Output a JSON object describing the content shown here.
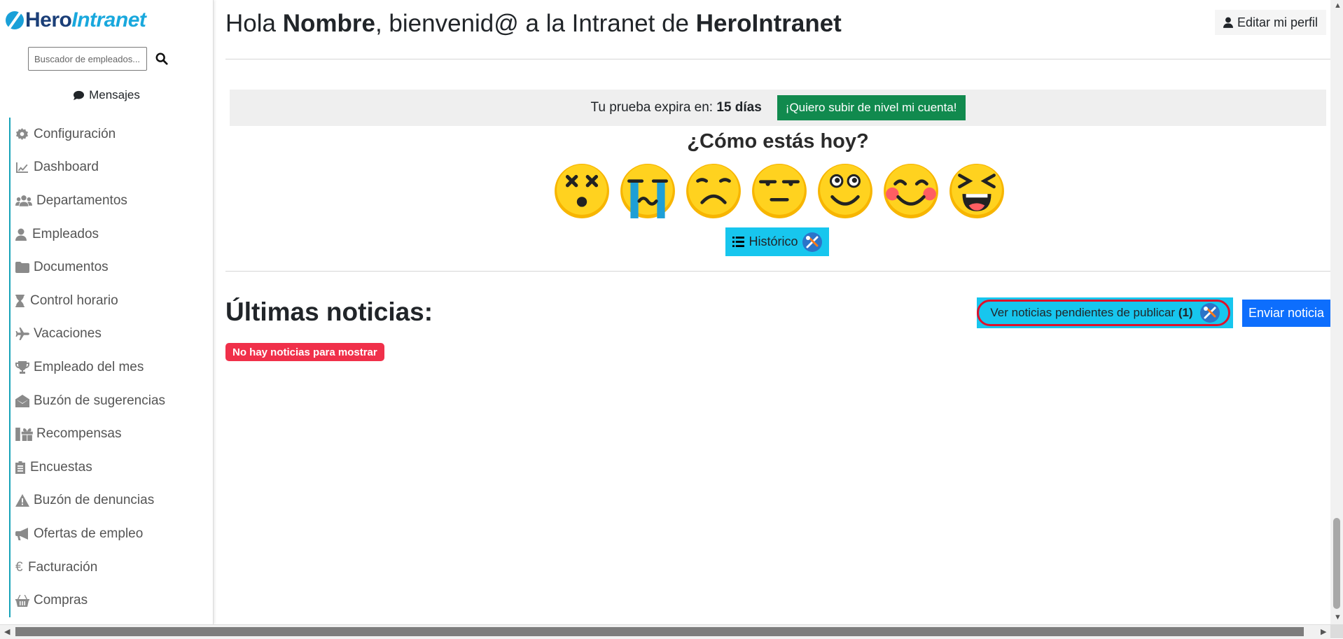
{
  "brand": {
    "hero": "Hero",
    "intranet": "Intranet"
  },
  "sidebar": {
    "search_placeholder": "Buscador de empleados...",
    "messages_label": "Mensajes",
    "items": [
      {
        "label": "Configuración",
        "icon": "gear-icon"
      },
      {
        "label": "Dashboard",
        "icon": "chart-line-icon"
      },
      {
        "label": "Departamentos",
        "icon": "users-icon"
      },
      {
        "label": "Empleados",
        "icon": "user-icon"
      },
      {
        "label": "Documentos",
        "icon": "folder-icon"
      },
      {
        "label": "Control horario",
        "icon": "hourglass-icon"
      },
      {
        "label": "Vacaciones",
        "icon": "plane-icon"
      },
      {
        "label": "Empleado del mes",
        "icon": "trophy-icon"
      },
      {
        "label": "Buzón de sugerencias",
        "icon": "envelope-open-icon"
      },
      {
        "label": "Recompensas",
        "icon": "gifts-icon"
      },
      {
        "label": "Encuestas",
        "icon": "clipboard-icon"
      },
      {
        "label": "Buzón de denuncias",
        "icon": "warning-icon"
      },
      {
        "label": "Ofertas de empleo",
        "icon": "megaphone-icon"
      },
      {
        "label": "Facturación",
        "icon": "euro-icon"
      },
      {
        "label": "Compras",
        "icon": "basket-icon"
      }
    ]
  },
  "header": {
    "title_pre": "Hola ",
    "title_name": "Nombre",
    "title_mid": ", bienvenid@ a la Intranet de ",
    "title_company": "HeroIntranet",
    "edit_profile": "Editar mi perfil"
  },
  "trial": {
    "text": "Tu prueba expira en: ",
    "days": "15 días",
    "upgrade": "¡Quiero subir de nivel mi cuenta!"
  },
  "mood": {
    "title": "¿Cómo estás hoy?",
    "faces": [
      "dizzy-face-icon",
      "crying-face-icon",
      "sad-face-icon",
      "unamused-face-icon",
      "happy-face-icon",
      "blushing-face-icon",
      "laughing-face-icon"
    ],
    "history": "Histórico"
  },
  "news": {
    "title": "Últimas noticias:",
    "empty": "No hay noticias para mostrar",
    "pending_label": "Ver noticias pendientes de publicar ",
    "pending_count": "(1)",
    "send": "Enviar noticia"
  },
  "colors": {
    "accent": "#17a2b8",
    "cyan_button": "#17c6ee",
    "green": "#118a4e",
    "blue": "#0d6efd",
    "danger": "#f0304a",
    "highlight": "#e0102a"
  }
}
